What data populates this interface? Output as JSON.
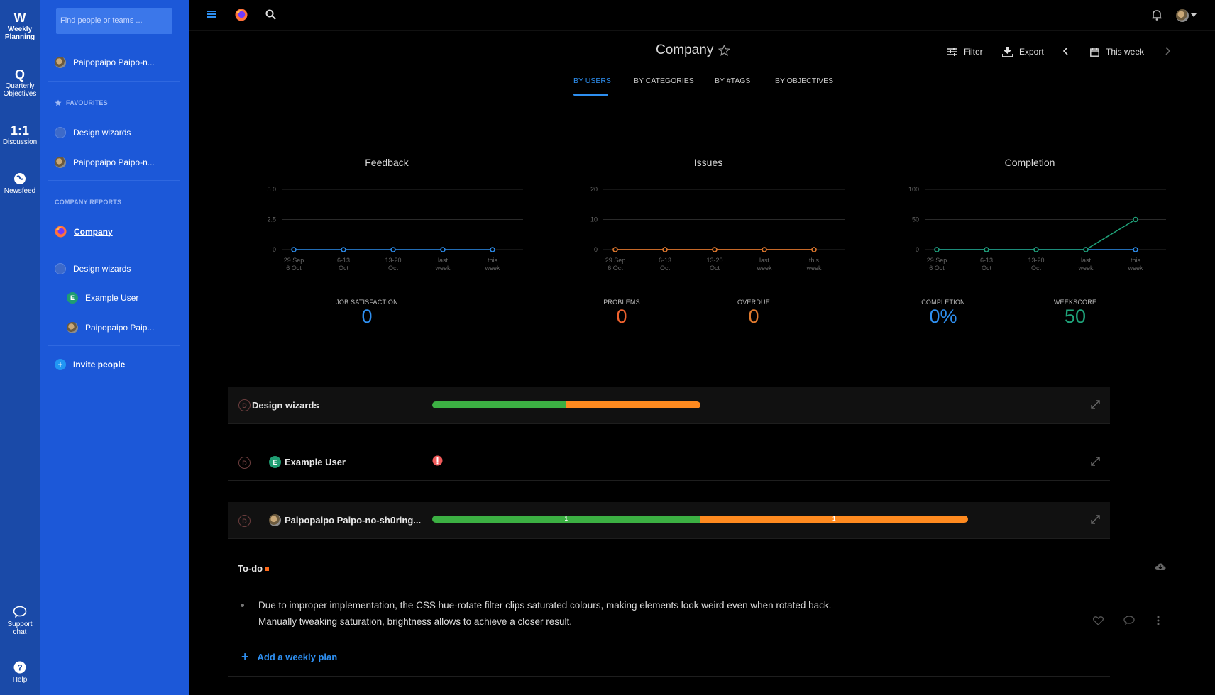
{
  "rail": {
    "weekly": {
      "letter": "W",
      "label_1": "Weekly",
      "label_2": "Planning"
    },
    "quarterly": {
      "letter": "Q",
      "label_1": "Quarterly",
      "label_2": "Objectives"
    },
    "discussion": {
      "letter": "1:1",
      "label": "Discussion"
    },
    "newsfeed": {
      "label": "Newsfeed"
    },
    "support": {
      "label_1": "Support",
      "label_2": "chat"
    },
    "help": {
      "label": "Help"
    }
  },
  "sidebar": {
    "search_placeholder": "Find people or teams ...",
    "me": "Paipopaipo Paipo-n...",
    "favourites_heading": "FAVOURITES",
    "favourites": [
      "Design wizards",
      "Paipopaipo Paipo-n..."
    ],
    "company_reports_heading": "COMPANY REPORTS",
    "company": "Company",
    "team": "Design wizards",
    "members": [
      {
        "initial": "E",
        "name": "Example User"
      },
      {
        "initial": "",
        "name": "Paipopaipo Paip..."
      }
    ],
    "invite": "Invite people"
  },
  "header": {
    "title": "Company",
    "filter": "Filter",
    "export": "Export",
    "period": "This week"
  },
  "tabs": [
    "BY USERS",
    "BY CATEGORIES",
    "BY #TAGS",
    "BY OBJECTIVES"
  ],
  "charts": {
    "feedback": {
      "title": "Feedback",
      "stats": [
        {
          "label": "JOB SATISFACTION",
          "value": "0"
        }
      ]
    },
    "issues": {
      "title": "Issues",
      "stats": [
        {
          "label": "PROBLEMS",
          "value": "0"
        },
        {
          "label": "OVERDUE",
          "value": "0"
        }
      ]
    },
    "completion": {
      "title": "Completion",
      "stats": [
        {
          "label": "COMPLETION",
          "value": "0%"
        },
        {
          "label": "WEEKSCORE",
          "value": "50"
        }
      ]
    }
  },
  "chart_data": [
    {
      "type": "line",
      "title": "Feedback",
      "x": [
        "29 Sep 6 Oct",
        "6-13 Oct",
        "13-20 Oct",
        "last week",
        "this week"
      ],
      "x_lines": [
        [
          "29 Sep",
          "6 Oct"
        ],
        [
          "6-13",
          "Oct"
        ],
        [
          "13-20",
          "Oct"
        ],
        [
          "last",
          "week"
        ],
        [
          "this",
          "week"
        ]
      ],
      "yticks": [
        "0",
        "2.5",
        "5.0"
      ],
      "ylim": [
        0,
        5
      ],
      "series": [
        {
          "values": [
            0,
            0,
            0,
            0,
            0
          ],
          "color": "#2e8ff0"
        }
      ],
      "grid": true
    },
    {
      "type": "line",
      "title": "Issues",
      "x": [
        "29 Sep 6 Oct",
        "6-13 Oct",
        "13-20 Oct",
        "last week",
        "this week"
      ],
      "x_lines": [
        [
          "29 Sep",
          "6 Oct"
        ],
        [
          "6-13",
          "Oct"
        ],
        [
          "13-20",
          "Oct"
        ],
        [
          "last",
          "week"
        ],
        [
          "this",
          "week"
        ]
      ],
      "yticks": [
        "0",
        "10",
        "20"
      ],
      "ylim": [
        0,
        20
      ],
      "series": [
        {
          "values": [
            0,
            0,
            0,
            0,
            0
          ],
          "color": "#f0622e"
        },
        {
          "values": [
            0,
            0,
            0,
            0,
            0
          ],
          "color": "#e07a2e"
        }
      ],
      "grid": true
    },
    {
      "type": "line",
      "title": "Completion",
      "x": [
        "29 Sep 6 Oct",
        "6-13 Oct",
        "13-20 Oct",
        "last week",
        "this week"
      ],
      "x_lines": [
        [
          "29 Sep",
          "6 Oct"
        ],
        [
          "6-13",
          "Oct"
        ],
        [
          "13-20",
          "Oct"
        ],
        [
          "last",
          "week"
        ],
        [
          "this",
          "week"
        ]
      ],
      "yticks": [
        "0",
        "50",
        "100"
      ],
      "ylim": [
        0,
        100
      ],
      "series": [
        {
          "values": [
            0,
            0,
            0,
            0,
            0
          ],
          "color": "#2e8ff0"
        },
        {
          "values": [
            0,
            0,
            0,
            0,
            50
          ],
          "color": "#1fa37a"
        }
      ],
      "grid": true
    }
  ],
  "rows": [
    {
      "name": "Design wizards",
      "bar": {
        "green": 0.5,
        "orange": 0.5,
        "labels": [
          "",
          ""
        ]
      }
    },
    {
      "name": "Example User",
      "initial": "E",
      "alert": true
    },
    {
      "name": "Paipopaipo Paipo-no-shūring...",
      "bar": {
        "green": 0.5,
        "orange": 0.5,
        "labels": [
          "1",
          "1"
        ]
      }
    }
  ],
  "todo": {
    "title": "To-do",
    "line_1": "Due to improper implementation, the CSS hue-rotate filter clips saturated colours, making elements look weird even when rotated back.",
    "line_2": "Manually tweaking saturation, brightness allows to achieve a closer result.",
    "add": "Add a weekly plan"
  },
  "colors": {
    "green": "#3cb043",
    "orange": "#ff8a1f",
    "blue": "#2e8ff0",
    "red": "#f0622e",
    "teal": "#1fa37a",
    "rail": "#1a4aa8",
    "sidebar": "#1c58d8"
  }
}
